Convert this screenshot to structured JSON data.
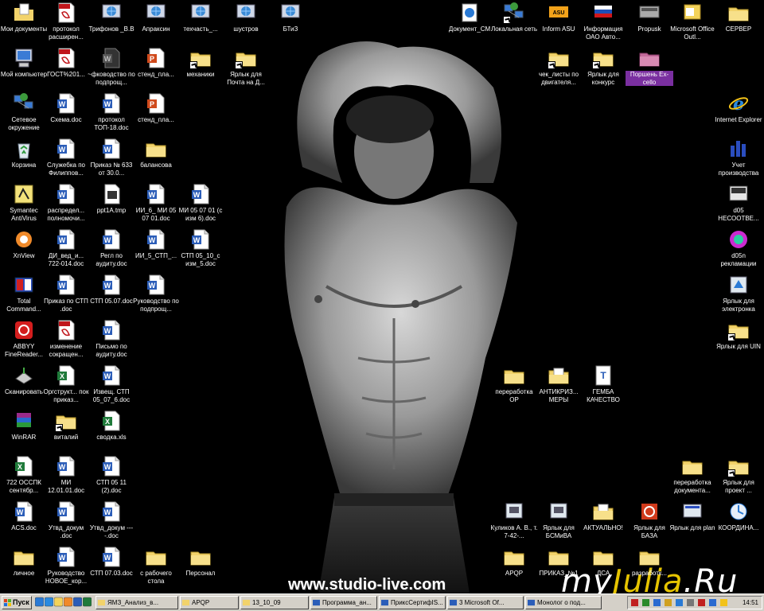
{
  "watermark": "www.studio-live.com",
  "logo": {
    "part1": "my",
    "part2": "Julia",
    "part3": ".Ru"
  },
  "icons": [
    {
      "id": "moi-dokumenty",
      "label": "Мои документы",
      "type": "mydocs"
    },
    {
      "id": "moi-kompyuter",
      "label": "Мой компьютер",
      "type": "computer"
    },
    {
      "id": "setevoe",
      "label": "Сетевое окружение",
      "type": "network"
    },
    {
      "id": "korzina",
      "label": "Корзина",
      "type": "recycle"
    },
    {
      "id": "symantec",
      "label": "Symantec AntiVirus",
      "type": "app-symantec"
    },
    {
      "id": "xnview",
      "label": "XnView",
      "type": "app-xnview"
    },
    {
      "id": "total-commander",
      "label": "Total Command...",
      "type": "app-tc"
    },
    {
      "id": "abbyy",
      "label": "ABBYY FineReader...",
      "type": "app-abbyy"
    },
    {
      "id": "skanirovat",
      "label": "Сканировать",
      "type": "app-scan"
    },
    {
      "id": "winrar",
      "label": "WinRAR",
      "type": "app-winrar"
    },
    {
      "id": "osspk",
      "label": "722 ОССПК сентябр...",
      "type": "xls"
    },
    {
      "id": "acs",
      "label": "ACS.doc",
      "type": "doc"
    },
    {
      "id": "lichnoe",
      "label": "личное",
      "type": "folder"
    },
    {
      "id": "protokol",
      "label": "протокол расширен...",
      "type": "pdf"
    },
    {
      "id": "gost",
      "label": "ГОСТ%201...",
      "type": "pdf"
    },
    {
      "id": "shema",
      "label": "Схема.doc",
      "type": "doc"
    },
    {
      "id": "sluzhebka",
      "label": "Служебка по Филиппов...",
      "type": "doc"
    },
    {
      "id": "raspredel",
      "label": "распредел... полномочи...",
      "type": "doc"
    },
    {
      "id": "di-ved",
      "label": "ДИ_вед_и... 722-014.doc",
      "type": "doc"
    },
    {
      "id": "prikaz-stp",
      "label": "Приказ по СТП .doc",
      "type": "doc"
    },
    {
      "id": "izmenenie",
      "label": "изменение сокращен...",
      "type": "pdf"
    },
    {
      "id": "orgstrukt",
      "label": "Оргструкт... пок приказ...",
      "type": "xls"
    },
    {
      "id": "vitaliy",
      "label": "виталий",
      "type": "folder-sc"
    },
    {
      "id": "mi-12",
      "label": "МИ 12.01.01.doc",
      "type": "doc"
    },
    {
      "id": "utvd-dokum",
      "label": "Утвд_докум .doc",
      "type": "doc"
    },
    {
      "id": "rukovodstvo-novoe",
      "label": "Руководство НОВОЕ_кор...",
      "type": "doc"
    },
    {
      "id": "trifonov",
      "label": "Трифонов _В.В",
      "type": "app-globe"
    },
    {
      "id": "rukovodstvo-podpr",
      "label": "~фководство по подпрощ...",
      "type": "doc-dark"
    },
    {
      "id": "protokol-top",
      "label": "протокол ТОП-18.doc",
      "type": "doc"
    },
    {
      "id": "prikaz-633",
      "label": "Приказ № 633 от 30.0...",
      "type": "doc"
    },
    {
      "id": "ppt1a",
      "label": "ppt1A.tmp",
      "type": "tmp"
    },
    {
      "id": "regl",
      "label": "Регл по аудиту.doc",
      "type": "doc"
    },
    {
      "id": "stp-05-07",
      "label": "СТП 05.07.doc",
      "type": "doc"
    },
    {
      "id": "pismo",
      "label": "Письмо по аудиту.doc",
      "type": "doc"
    },
    {
      "id": "izvesh",
      "label": "Извещ. СТП 05_07_6.doc",
      "type": "doc"
    },
    {
      "id": "svodka",
      "label": "сводка.xls",
      "type": "xls"
    },
    {
      "id": "stp-05-11",
      "label": "СТП 05 11 (2).doc",
      "type": "doc"
    },
    {
      "id": "utvd-dokum2",
      "label": "Утвд_докум ----.doc",
      "type": "doc"
    },
    {
      "id": "stp-07-03",
      "label": "СТП 07.03.doc",
      "type": "doc"
    },
    {
      "id": "apraksin",
      "label": "Апраксин",
      "type": "app-globe"
    },
    {
      "id": "stend-1",
      "label": "стенд_пла...",
      "type": "ppt"
    },
    {
      "id": "stend-2",
      "label": "стенд_пла...",
      "type": "ppt"
    },
    {
      "id": "balansova",
      "label": "балансова",
      "type": "folder"
    },
    {
      "id": "ii-6",
      "label": "ИИ_6_ МИ 05 07 01.doc",
      "type": "doc"
    },
    {
      "id": "ii-5",
      "label": "ИИ_5_СТП_...",
      "type": "doc"
    },
    {
      "id": "rukovodstvo-podpr2",
      "label": "Руководство по подпрощ...",
      "type": "doc"
    },
    {
      "id": "s-rabochego",
      "label": "с рабочего стола",
      "type": "folder"
    },
    {
      "id": "tehchast",
      "label": "техчасть_...",
      "type": "app-globe"
    },
    {
      "id": "mehaniki",
      "label": "механики",
      "type": "folder-sc"
    },
    {
      "id": "mi-05-07",
      "label": "МИ 05 07 01 (с изм 6).doc",
      "type": "doc"
    },
    {
      "id": "stp-05-10",
      "label": "СТП 05_10_с изм_5.doc",
      "type": "doc"
    },
    {
      "id": "personal",
      "label": "Персонал",
      "type": "folder"
    },
    {
      "id": "shustrov",
      "label": "шустров",
      "type": "app-globe"
    },
    {
      "id": "pochta",
      "label": "Ярлык для Почта на Д...",
      "type": "folder-sc"
    },
    {
      "id": "btiz",
      "label": "БТиЗ",
      "type": "app-globe"
    },
    {
      "id": "dokument-sm",
      "label": "Документ_СМ",
      "type": "app-doc-sm"
    },
    {
      "id": "lokalnaya-set",
      "label": "Локальная сеть",
      "type": "network-sc"
    },
    {
      "id": "inform-asu",
      "label": "Inform ASU",
      "type": "app-asu"
    },
    {
      "id": "informaciya",
      "label": "Информация ОАО Авто...",
      "type": "app-flag"
    },
    {
      "id": "propusk",
      "label": "Propusk",
      "type": "app-propusk"
    },
    {
      "id": "ms-outlook",
      "label": "Microsoft Office Outl...",
      "type": "app-outlook"
    },
    {
      "id": "server",
      "label": "СЕРВЕР",
      "type": "folder"
    },
    {
      "id": "chek-listy",
      "label": "чек_листы по двигателя...",
      "type": "folder-sc"
    },
    {
      "id": "konkurs",
      "label": "Ярлык для конкурс",
      "type": "folder-sc"
    },
    {
      "id": "porshen",
      "label": "Поршень Ex-cello",
      "type": "folder-pink",
      "selected": true
    },
    {
      "id": "ie",
      "label": "Internet Explorer",
      "type": "app-ie"
    },
    {
      "id": "uchet",
      "label": "Учет производства",
      "type": "app-uchet"
    },
    {
      "id": "d05-nesootv",
      "label": "d05 НЕСООТВЕ...",
      "type": "app-d05"
    },
    {
      "id": "d05n",
      "label": "d05n рекламации",
      "type": "app-d05n"
    },
    {
      "id": "elektronka",
      "label": "Ярлык для электронка",
      "type": "app-elektronka"
    },
    {
      "id": "uin",
      "label": "Ярлык для UIN",
      "type": "folder-sc"
    },
    {
      "id": "pererabotka-or",
      "label": "переработка ОР",
      "type": "folder"
    },
    {
      "id": "antikriz",
      "label": "АНТИКРИЗ... МЕРЫ",
      "type": "folder-doc"
    },
    {
      "id": "gemba",
      "label": "ГЕМБА КАЧЕСТВО",
      "type": "app-gemba"
    },
    {
      "id": "pererabotka-dok",
      "label": "переработка документа...",
      "type": "folder"
    },
    {
      "id": "proekt",
      "label": "Ярлык для проект ...",
      "type": "folder-sc"
    },
    {
      "id": "kulikov",
      "label": "Куликов А. В., т. 7-42-...",
      "type": "app-box"
    },
    {
      "id": "bsmiva",
      "label": "Ярлык для БСМиВА",
      "type": "app-box"
    },
    {
      "id": "aktualno",
      "label": "АКТУАЛЬНО!",
      "type": "folder-doc"
    },
    {
      "id": "baza",
      "label": "Ярлык для БАЗА",
      "type": "app-baza"
    },
    {
      "id": "plan",
      "label": "Ярлык для plan",
      "type": "app-plan"
    },
    {
      "id": "koordina",
      "label": "КООРДИНА...",
      "type": "app-koord"
    },
    {
      "id": "apqp-desk",
      "label": "APQP",
      "type": "folder"
    },
    {
      "id": "prikaz-1",
      "label": "ПРИКАЗ_№1",
      "type": "folder"
    },
    {
      "id": "dsa",
      "label": "ДСА",
      "type": "folder"
    },
    {
      "id": "razrabotka",
      "label": "разработк...",
      "type": "folder"
    }
  ],
  "taskbar": {
    "start_label": "Пуск",
    "tasks": [
      {
        "label": "ЯМЗ_Анализ_в...",
        "type": "folder"
      },
      {
        "label": "APQP",
        "type": "folder"
      },
      {
        "label": "13_10_09",
        "type": "folder"
      },
      {
        "label": "Программа_ан...",
        "type": "doc"
      },
      {
        "label": "ПриксСертифІS...",
        "type": "doc"
      },
      {
        "label": "3 Microsoft Of...",
        "type": "doc"
      },
      {
        "label": "Монолог о под...",
        "type": "doc"
      }
    ],
    "clock": "14:51"
  }
}
